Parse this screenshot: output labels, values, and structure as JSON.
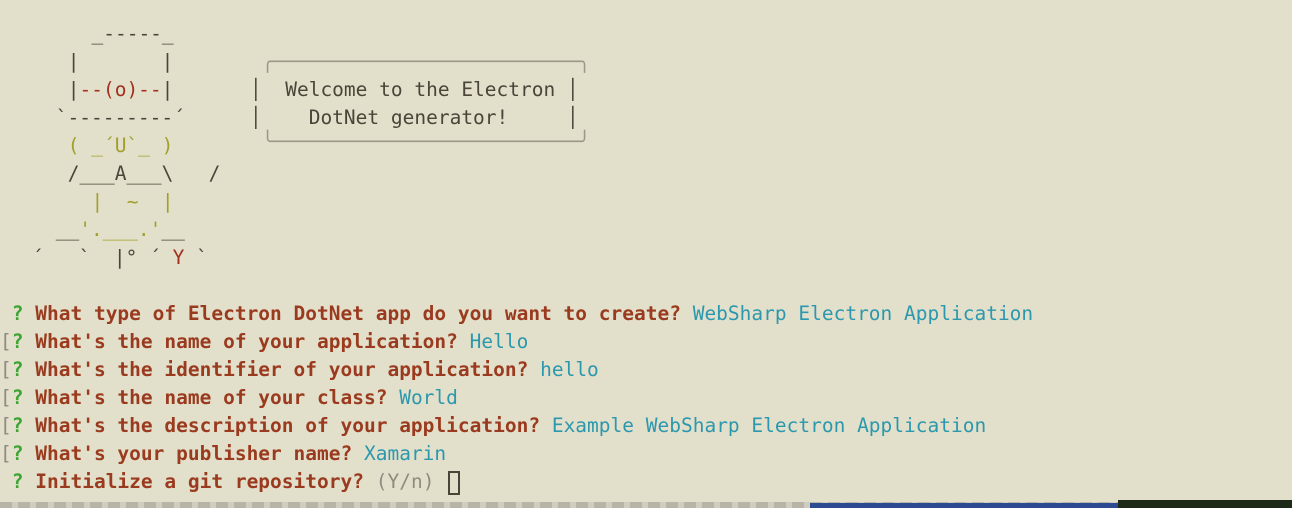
{
  "yeoman_art": {
    "lines": [
      "  _-----_",
      " |       |",
      " |--(o)--|",
      "`---------´",
      " ( _´U`_ )",
      " /___A___\\   /",
      "  |  ~  |",
      "__'.___.'__",
      "´   `  |° ´ Y `"
    ]
  },
  "speech_bubble": {
    "top": " ╭──────────────────────────╮",
    "line1": "│  Welcome to the Electron │",
    "line2": "│    DotNet generator!     │",
    "bottom": " ╰──────────────────────────╯"
  },
  "prompts": [
    {
      "prefix": " ",
      "mark": "?",
      "question": "What type of Electron DotNet app do you want to create?",
      "answer": "WebSharp Electron Application"
    },
    {
      "prefix": "[",
      "mark": "?",
      "question": "What's the name of your application?",
      "answer": "Hello"
    },
    {
      "prefix": "[",
      "mark": "?",
      "question": "What's the identifier of your application?",
      "answer": "hello"
    },
    {
      "prefix": "[",
      "mark": "?",
      "question": "What's the name of your class?",
      "answer": "World"
    },
    {
      "prefix": "[",
      "mark": "?",
      "question": "What's the description of your application?",
      "answer": "Example WebSharp Electron Application"
    },
    {
      "prefix": "[",
      "mark": "?",
      "question": "What's your publisher name?",
      "answer": "Xamarin"
    }
  ],
  "current_prompt": {
    "prefix": " ",
    "mark": "?",
    "question": "Initialize a git repository?",
    "hint": "(Y/n)"
  },
  "colors": {
    "background": "#e2dfcb",
    "question_mark": "#3da531",
    "question": "#9a3b1f",
    "answer": "#2b98ad",
    "hint": "#8f8c7f"
  }
}
